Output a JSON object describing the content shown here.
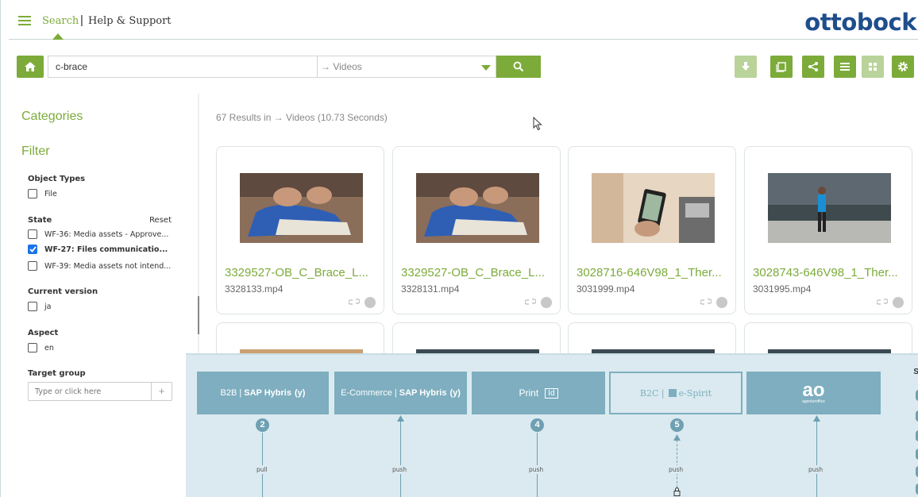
{
  "topnav": {
    "search_label": "Search",
    "separator": "|",
    "help_label": "Help & Support",
    "logo_text": "ottobock",
    "menu_icon": "hamburger-menu-icon"
  },
  "searchbar": {
    "query": "c-brace",
    "scope": "→ Videos",
    "home_icon": "home-icon",
    "search_icon": "search-icon"
  },
  "toolbar": {
    "buttons": [
      "download-icon",
      "clipboard-icon",
      "share-icon",
      "list-view-icon",
      "grid-view-icon",
      "gear-icon"
    ]
  },
  "sidebar": {
    "categories_heading": "Categories",
    "filter_heading": "Filter",
    "facets": {
      "object_types": {
        "title": "Object Types",
        "options": [
          {
            "label": "File",
            "checked": false
          }
        ]
      },
      "state": {
        "title": "State",
        "reset_label": "Reset",
        "options": [
          {
            "label": "WF-36: Media assets - Approve...",
            "checked": false
          },
          {
            "label": "WF-27: Files communicatio...",
            "checked": true
          },
          {
            "label": "WF-39: Media assets not intend...",
            "checked": false
          }
        ]
      },
      "current_version": {
        "title": "Current version",
        "options": [
          {
            "label": "ja",
            "checked": false
          }
        ]
      },
      "aspect": {
        "title": "Aspect",
        "options": [
          {
            "label": "en",
            "checked": false
          }
        ]
      },
      "target_group": {
        "title": "Target group",
        "placeholder": "Type or click here",
        "add_label": "+"
      }
    }
  },
  "results": {
    "summary": "67 Results in → Videos (10.73 Seconds)",
    "cards": [
      {
        "title": "3329527-OB_C_Brace_L...",
        "file": "3328133.mp4",
        "thumb": "brace"
      },
      {
        "title": "3329527-OB_C_Brace_L...",
        "file": "3328131.mp4",
        "thumb": "brace"
      },
      {
        "title": "3028716-646V98_1_Ther...",
        "file": "3031999.mp4",
        "thumb": "phone"
      },
      {
        "title": "3028743-646V98_1_Ther...",
        "file": "3031995.mp4",
        "thumb": "walk"
      }
    ]
  },
  "diagram": {
    "systems": [
      {
        "prefix": "B2B |",
        "name": "SAP Hybris",
        "icon": "(y)"
      },
      {
        "prefix": "E-Commerce |",
        "name": "SAP Hybris",
        "icon": "(y)"
      },
      {
        "prefix": "Print",
        "name": "",
        "icon": "Id"
      },
      {
        "prefix": "B2C |",
        "name": "e-Spirit",
        "icon": ""
      },
      {
        "prefix": "",
        "name": "ao",
        "icon": "agenturoffice"
      }
    ],
    "flows": [
      {
        "badge": "2",
        "label": "pull"
      },
      {
        "badge": "",
        "label": "push"
      },
      {
        "badge": "4",
        "label": "push"
      },
      {
        "badge": "5",
        "label": "push"
      },
      {
        "badge": "",
        "label": "push"
      }
    ],
    "edge_letter": "S"
  }
}
